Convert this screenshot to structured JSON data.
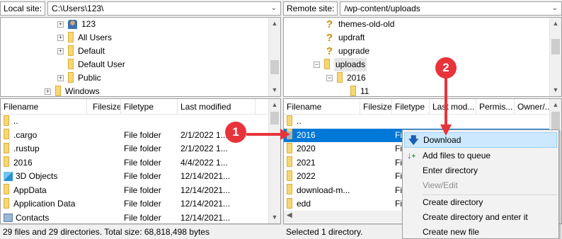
{
  "local": {
    "site_label": "Local site:",
    "path": "C:\\Users\\123\\",
    "tree": [
      {
        "label": "123",
        "icon": "user-folder-icon",
        "expander": "+"
      },
      {
        "label": "All Users",
        "icon": "folder-icon",
        "expander": "+"
      },
      {
        "label": "Default",
        "icon": "folder-icon",
        "expander": "+"
      },
      {
        "label": "Default User",
        "icon": "folder-icon",
        "expander": ""
      },
      {
        "label": "Public",
        "icon": "folder-icon",
        "expander": "+"
      },
      {
        "label": "Windows",
        "icon": "folder-icon",
        "expander": "+"
      }
    ],
    "columns": [
      "Filename",
      "Filesize",
      "Filetype",
      "Last modified"
    ],
    "rows": [
      {
        "name": "..",
        "type": "",
        "modified": ""
      },
      {
        "name": ".cargo",
        "type": "File folder",
        "modified": "2/1/2022 1..."
      },
      {
        "name": ".rustup",
        "type": "File folder",
        "modified": "2/1/2022 1..."
      },
      {
        "name": "2016",
        "type": "File folder",
        "modified": "4/4/2022 1..."
      },
      {
        "name": "3D Objects",
        "type": "File folder",
        "modified": "12/14/2021..."
      },
      {
        "name": "AppData",
        "type": "File folder",
        "modified": "12/14/2021..."
      },
      {
        "name": "Application Data",
        "type": "File folder",
        "modified": "12/14/2021..."
      },
      {
        "name": "Contacts",
        "type": "File folder",
        "modified": "12/14/2021..."
      }
    ],
    "status": "29 files and 29 directories. Total size: 68,818,498 bytes"
  },
  "remote": {
    "site_label": "Remote site:",
    "path": "/wp-content/uploads",
    "tree": [
      {
        "label": "themes-old-old",
        "icon": "unknown-icon"
      },
      {
        "label": "updraft",
        "icon": "unknown-icon"
      },
      {
        "label": "upgrade",
        "icon": "unknown-icon"
      },
      {
        "label": "uploads",
        "icon": "folder-icon"
      },
      {
        "label": "2016",
        "icon": "folder-icon"
      },
      {
        "label": "11",
        "icon": "folder-icon"
      }
    ],
    "columns": [
      "Filename",
      "Filesize",
      "Filetype",
      "Last mod...",
      "Permis...",
      "Owner/..."
    ],
    "rows": [
      {
        "name": "..",
        "type": ""
      },
      {
        "name": "2016",
        "type": "Fil"
      },
      {
        "name": "2020",
        "type": "Fil"
      },
      {
        "name": "2021",
        "type": "Fil"
      },
      {
        "name": "2022",
        "type": "Fil"
      },
      {
        "name": "download-m...",
        "type": "Fil"
      },
      {
        "name": "edd",
        "type": "Fil"
      }
    ],
    "status": "Selected 1 directory."
  },
  "context_menu": {
    "items": [
      "Download",
      "Add files to queue",
      "Enter directory",
      "View/Edit",
      "Create directory",
      "Create directory and enter it",
      "Create new file"
    ]
  },
  "annotations": {
    "badge1": "1",
    "badge2": "2"
  },
  "colors": {
    "selection": "#0078d7",
    "highlight": "#cce8ff",
    "badge": "#e8333b",
    "folder": "#f7d774"
  }
}
